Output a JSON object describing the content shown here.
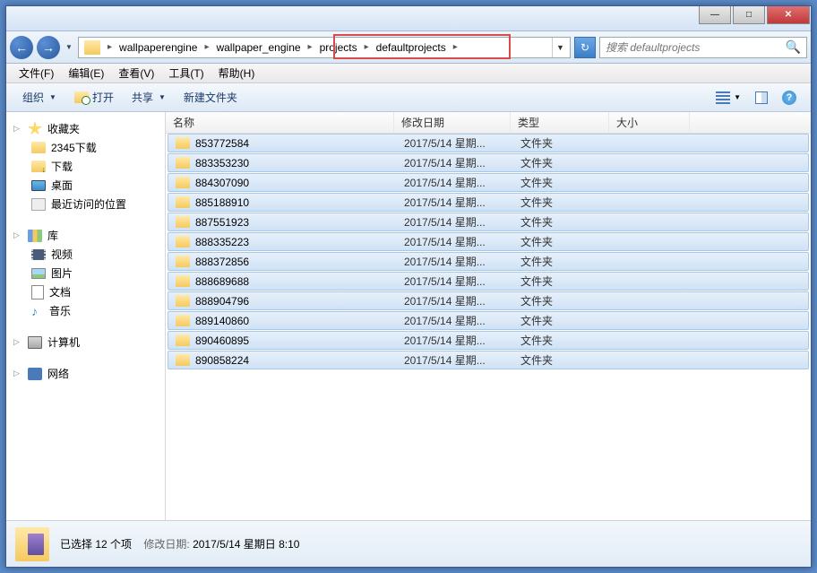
{
  "title_buttons": {
    "min": "—",
    "max": "□",
    "close": "✕"
  },
  "nav": {
    "back": "←",
    "fwd": "→"
  },
  "breadcrumb": [
    "wallpaperengine",
    "wallpaper_engine",
    "projects",
    "defaultprojects"
  ],
  "search": {
    "placeholder": "搜索 defaultprojects"
  },
  "menubar": [
    "文件(F)",
    "编辑(E)",
    "查看(V)",
    "工具(T)",
    "帮助(H)"
  ],
  "toolbar": {
    "organize": "组织",
    "open": "打开",
    "share": "共享",
    "newfolder": "新建文件夹"
  },
  "sidebar": {
    "favorites": {
      "label": "收藏夹",
      "items": [
        "2345下载",
        "下载",
        "桌面",
        "最近访问的位置"
      ]
    },
    "libraries": {
      "label": "库",
      "items": [
        "视频",
        "图片",
        "文档",
        "音乐"
      ]
    },
    "computer": {
      "label": "计算机"
    },
    "network": {
      "label": "网络"
    }
  },
  "columns": {
    "name": "名称",
    "date": "修改日期",
    "type": "类型",
    "size": "大小"
  },
  "files": [
    {
      "name": "853772584",
      "date": "2017/5/14 星期...",
      "type": "文件夹"
    },
    {
      "name": "883353230",
      "date": "2017/5/14 星期...",
      "type": "文件夹"
    },
    {
      "name": "884307090",
      "date": "2017/5/14 星期...",
      "type": "文件夹"
    },
    {
      "name": "885188910",
      "date": "2017/5/14 星期...",
      "type": "文件夹"
    },
    {
      "name": "887551923",
      "date": "2017/5/14 星期...",
      "type": "文件夹"
    },
    {
      "name": "888335223",
      "date": "2017/5/14 星期...",
      "type": "文件夹"
    },
    {
      "name": "888372856",
      "date": "2017/5/14 星期...",
      "type": "文件夹"
    },
    {
      "name": "888689688",
      "date": "2017/5/14 星期...",
      "type": "文件夹"
    },
    {
      "name": "888904796",
      "date": "2017/5/14 星期...",
      "type": "文件夹"
    },
    {
      "name": "889140860",
      "date": "2017/5/14 星期...",
      "type": "文件夹"
    },
    {
      "name": "890460895",
      "date": "2017/5/14 星期...",
      "type": "文件夹"
    },
    {
      "name": "890858224",
      "date": "2017/5/14 星期...",
      "type": "文件夹"
    }
  ],
  "status": {
    "selection": "已选择 12 个项",
    "date_label": "修改日期:",
    "date_value": "2017/5/14 星期日 8:10"
  }
}
